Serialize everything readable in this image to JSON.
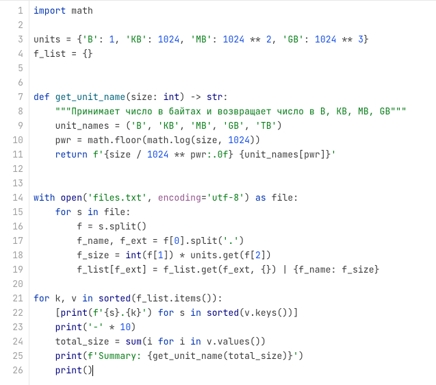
{
  "total_lines": 26,
  "caret_line": 26,
  "lines": [
    {
      "n": 1,
      "tokens": [
        [
          "kw",
          "import"
        ],
        [
          "txt",
          " math"
        ]
      ]
    },
    {
      "n": 2,
      "tokens": []
    },
    {
      "n": 3,
      "tokens": [
        [
          "txt",
          "units = {"
        ],
        [
          "str",
          "'B'"
        ],
        [
          "txt",
          ": "
        ],
        [
          "num",
          "1"
        ],
        [
          "txt",
          ", "
        ],
        [
          "str",
          "'KB'"
        ],
        [
          "txt",
          ": "
        ],
        [
          "num",
          "1024"
        ],
        [
          "txt",
          ", "
        ],
        [
          "str",
          "'MB'"
        ],
        [
          "txt",
          ": "
        ],
        [
          "num",
          "1024"
        ],
        [
          "txt",
          " ** "
        ],
        [
          "num",
          "2"
        ],
        [
          "txt",
          ", "
        ],
        [
          "str",
          "'GB'"
        ],
        [
          "txt",
          ": "
        ],
        [
          "num",
          "1024"
        ],
        [
          "txt",
          " ** "
        ],
        [
          "num",
          "3"
        ],
        [
          "txt",
          "}"
        ]
      ]
    },
    {
      "n": 4,
      "tokens": [
        [
          "txt",
          "f_list = {}"
        ]
      ]
    },
    {
      "n": 5,
      "tokens": []
    },
    {
      "n": 6,
      "tokens": []
    },
    {
      "n": 7,
      "tokens": [
        [
          "kw",
          "def "
        ],
        [
          "def",
          "get_unit_name"
        ],
        [
          "txt",
          "(size: "
        ],
        [
          "builtin",
          "int"
        ],
        [
          "txt",
          ") -> "
        ],
        [
          "builtin",
          "str"
        ],
        [
          "txt",
          ":"
        ]
      ]
    },
    {
      "n": 8,
      "tokens": [
        [
          "txt",
          "    "
        ],
        [
          "str",
          "\"\"\"Принимает число в байтах и возвращает число в B, KB, MB, GB\"\"\""
        ]
      ]
    },
    {
      "n": 9,
      "tokens": [
        [
          "txt",
          "    unit_names = ("
        ],
        [
          "str",
          "'B'"
        ],
        [
          "txt",
          ", "
        ],
        [
          "str",
          "'KB'"
        ],
        [
          "txt",
          ", "
        ],
        [
          "str",
          "'MB'"
        ],
        [
          "txt",
          ", "
        ],
        [
          "str",
          "'GB'"
        ],
        [
          "txt",
          ", "
        ],
        [
          "str",
          "'TB'"
        ],
        [
          "txt",
          ")"
        ]
      ]
    },
    {
      "n": 10,
      "tokens": [
        [
          "txt",
          "    pwr = math.floor(math.log(size, "
        ],
        [
          "num",
          "1024"
        ],
        [
          "txt",
          "))"
        ]
      ]
    },
    {
      "n": 11,
      "tokens": [
        [
          "txt",
          "    "
        ],
        [
          "kw",
          "return "
        ],
        [
          "str",
          "f'"
        ],
        [
          "txt",
          "{size / "
        ],
        [
          "num",
          "1024"
        ],
        [
          "txt",
          " ** pwr"
        ],
        [
          "str",
          ":.0f"
        ],
        [
          "txt",
          "}"
        ],
        [
          "str",
          " "
        ],
        [
          "txt",
          "{unit_names[pwr]}"
        ],
        [
          "str",
          "'"
        ]
      ]
    },
    {
      "n": 12,
      "tokens": []
    },
    {
      "n": 13,
      "tokens": []
    },
    {
      "n": 14,
      "tokens": [
        [
          "kw",
          "with "
        ],
        [
          "builtin",
          "open"
        ],
        [
          "txt",
          "("
        ],
        [
          "str",
          "'files.txt'"
        ],
        [
          "txt",
          ", "
        ],
        [
          "self",
          "encoding"
        ],
        [
          "txt",
          "="
        ],
        [
          "str",
          "'utf-8'"
        ],
        [
          "txt",
          ") "
        ],
        [
          "kw",
          "as "
        ],
        [
          "txt",
          "file:"
        ]
      ]
    },
    {
      "n": 15,
      "tokens": [
        [
          "txt",
          "    "
        ],
        [
          "kw",
          "for "
        ],
        [
          "txt",
          "s "
        ],
        [
          "kw",
          "in "
        ],
        [
          "txt",
          "file:"
        ]
      ]
    },
    {
      "n": 16,
      "tokens": [
        [
          "txt",
          "        f = s.split()"
        ]
      ]
    },
    {
      "n": 17,
      "tokens": [
        [
          "txt",
          "        f_name, f_ext = f["
        ],
        [
          "num",
          "0"
        ],
        [
          "txt",
          "].split("
        ],
        [
          "str",
          "'.'"
        ],
        [
          "txt",
          ")"
        ]
      ]
    },
    {
      "n": 18,
      "tokens": [
        [
          "txt",
          "        f_size = "
        ],
        [
          "builtin",
          "int"
        ],
        [
          "txt",
          "(f["
        ],
        [
          "num",
          "1"
        ],
        [
          "txt",
          "]) * units.get(f["
        ],
        [
          "num",
          "2"
        ],
        [
          "txt",
          "])"
        ]
      ]
    },
    {
      "n": 19,
      "tokens": [
        [
          "txt",
          "        f_list[f_ext] = f_list.get(f_ext, {}) | {f_name: f_size}"
        ]
      ]
    },
    {
      "n": 20,
      "tokens": []
    },
    {
      "n": 21,
      "tokens": [
        [
          "kw",
          "for "
        ],
        [
          "txt",
          "k, v "
        ],
        [
          "kw",
          "in "
        ],
        [
          "builtin",
          "sorted"
        ],
        [
          "txt",
          "(f_list.items()):"
        ]
      ]
    },
    {
      "n": 22,
      "tokens": [
        [
          "txt",
          "    ["
        ],
        [
          "builtin",
          "print"
        ],
        [
          "txt",
          "("
        ],
        [
          "str",
          "f'"
        ],
        [
          "txt",
          "{s}"
        ],
        [
          "str",
          "."
        ],
        [
          "txt",
          "{k}"
        ],
        [
          "str",
          "'"
        ],
        [
          "txt",
          ") "
        ],
        [
          "kw",
          "for "
        ],
        [
          "txt",
          "s "
        ],
        [
          "kw",
          "in "
        ],
        [
          "builtin",
          "sorted"
        ],
        [
          "txt",
          "(v.keys())]"
        ]
      ]
    },
    {
      "n": 23,
      "tokens": [
        [
          "txt",
          "    "
        ],
        [
          "builtin",
          "print"
        ],
        [
          "txt",
          "("
        ],
        [
          "str",
          "'-'"
        ],
        [
          "txt",
          " * "
        ],
        [
          "num",
          "10"
        ],
        [
          "txt",
          ")"
        ]
      ]
    },
    {
      "n": 24,
      "tokens": [
        [
          "txt",
          "    total_size = "
        ],
        [
          "builtin",
          "sum"
        ],
        [
          "txt",
          "(i "
        ],
        [
          "kw",
          "for "
        ],
        [
          "txt",
          "i "
        ],
        [
          "kw",
          "in "
        ],
        [
          "txt",
          "v.values())"
        ]
      ]
    },
    {
      "n": 25,
      "tokens": [
        [
          "txt",
          "    "
        ],
        [
          "builtin",
          "print"
        ],
        [
          "txt",
          "("
        ],
        [
          "str",
          "f'Summary: "
        ],
        [
          "txt",
          "{get_unit_name(total_size)}"
        ],
        [
          "str",
          "'"
        ],
        [
          "txt",
          ")"
        ]
      ]
    },
    {
      "n": 26,
      "tokens": [
        [
          "txt",
          "    "
        ],
        [
          "builtin",
          "print"
        ],
        [
          "txt",
          "()"
        ]
      ]
    }
  ]
}
